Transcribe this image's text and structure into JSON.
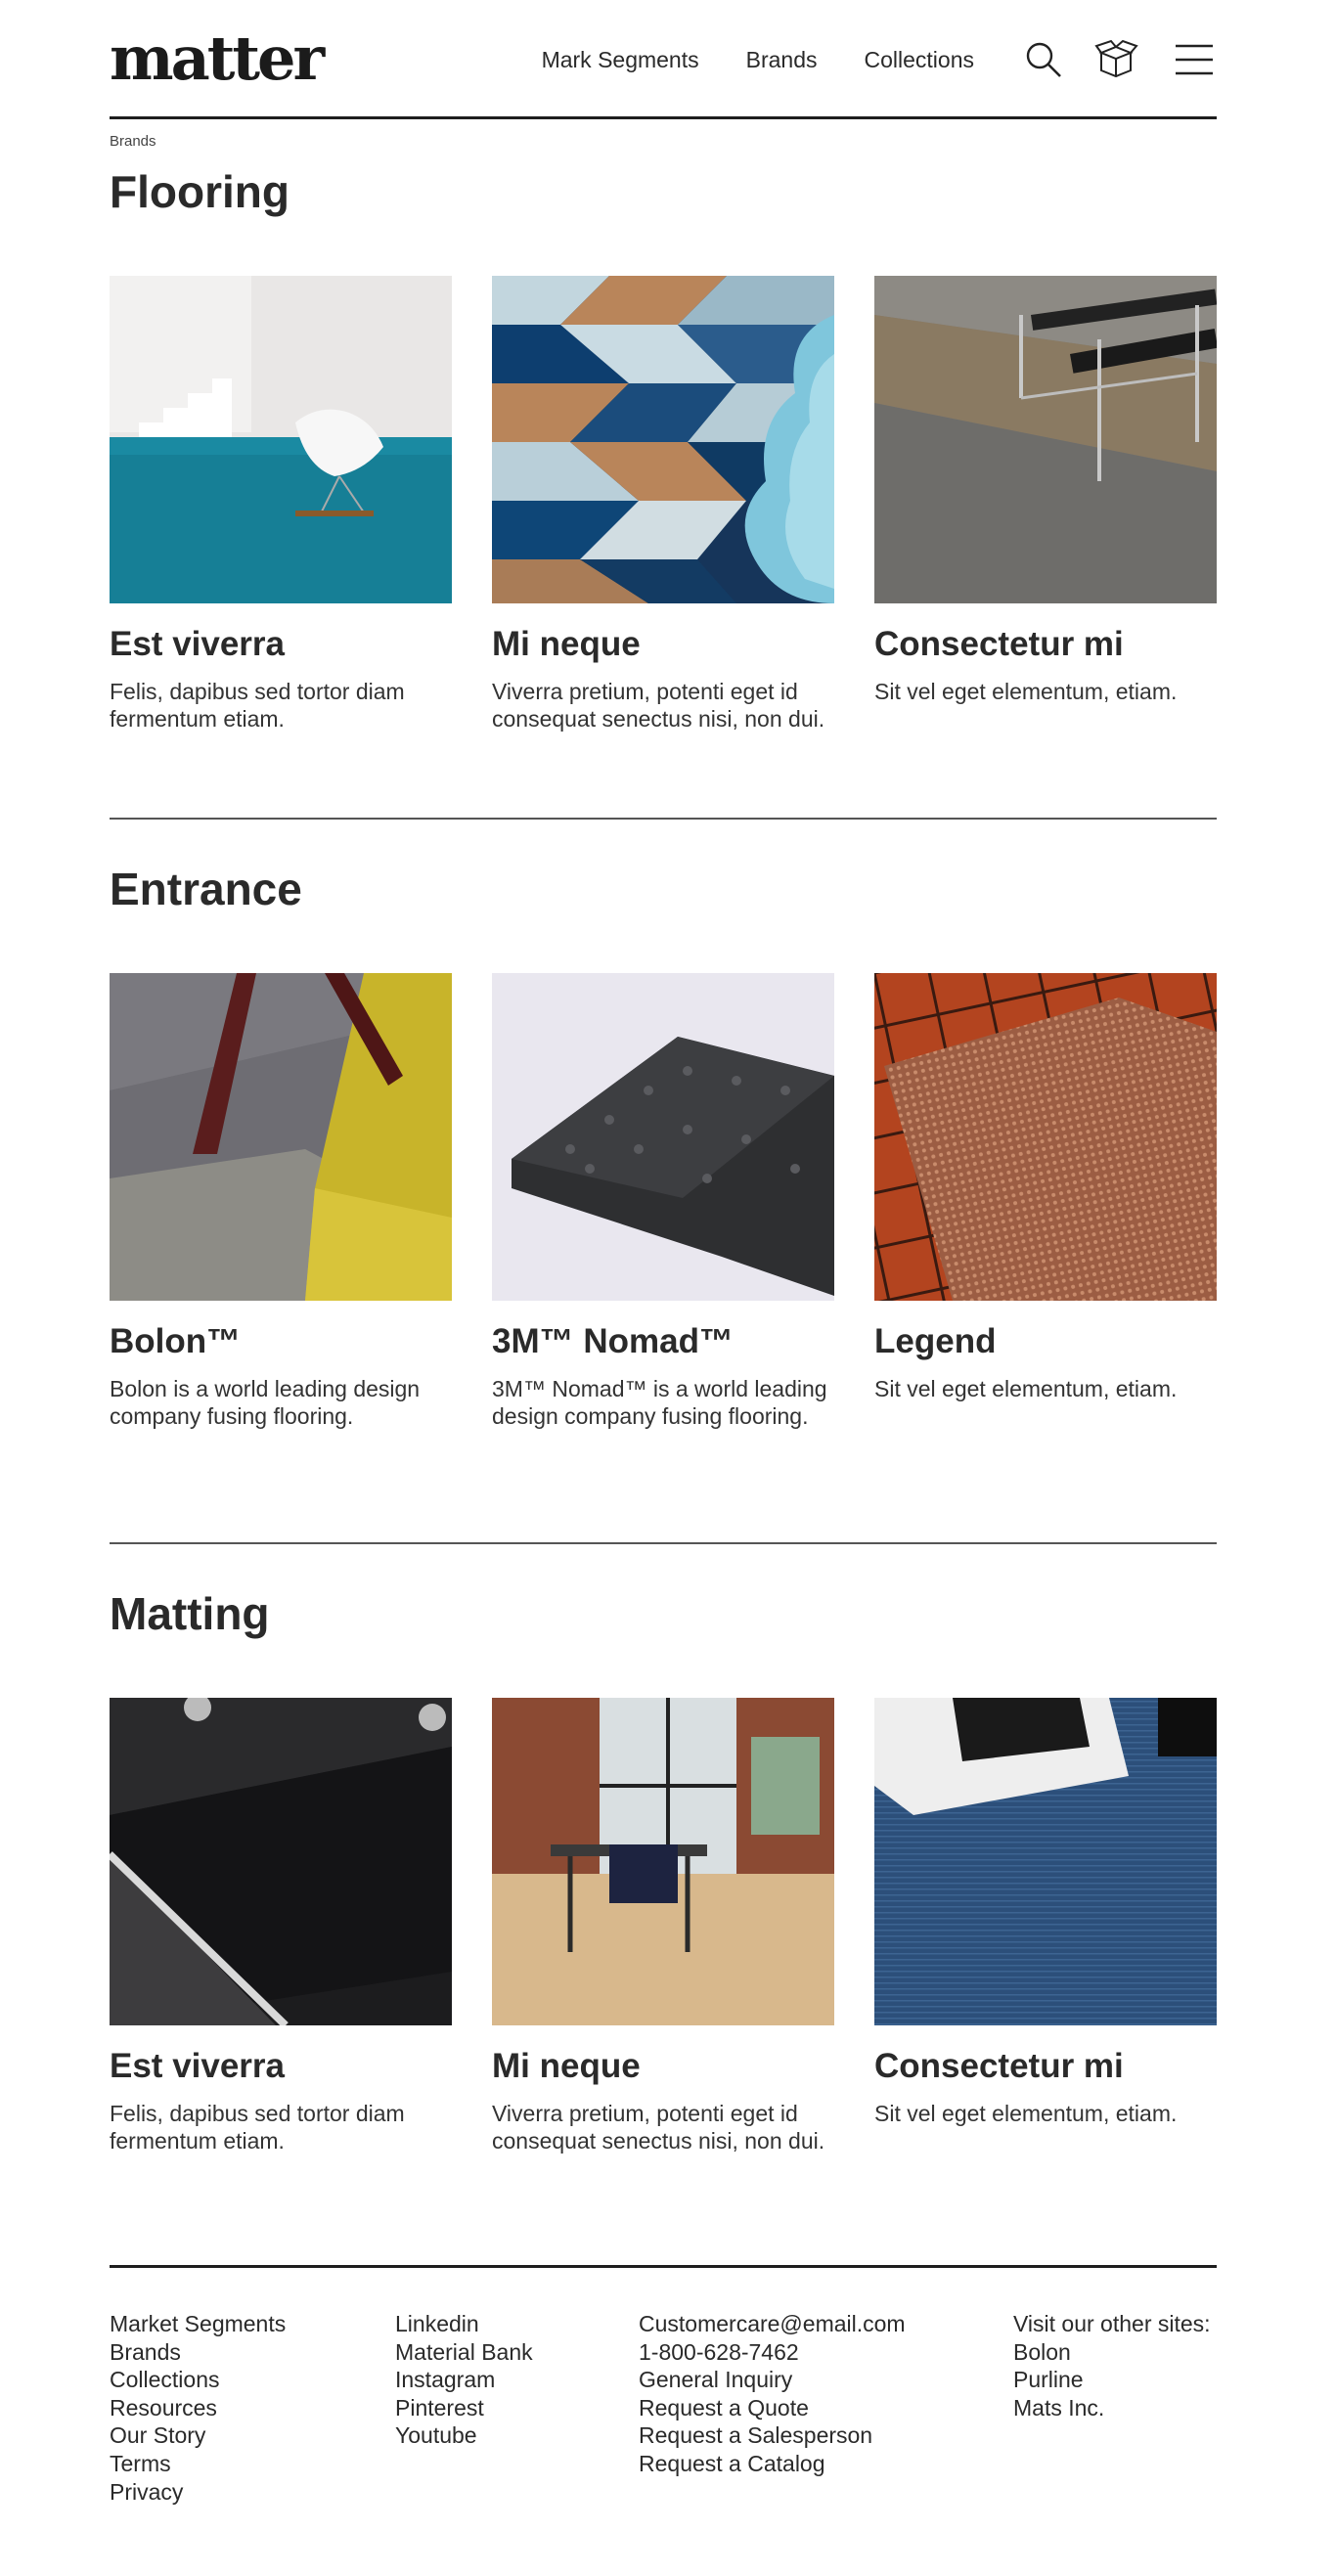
{
  "header": {
    "logo": "matter",
    "nav": [
      "Mark Segments",
      "Brands",
      "Collections"
    ],
    "icons": [
      "search-icon",
      "box-icon",
      "menu-icon"
    ]
  },
  "breadcrumb": "Brands",
  "sections": [
    {
      "title": "Flooring",
      "cards": [
        {
          "title": "Est viverra",
          "desc": "Felis, dapibus sed tortor diam fermentum etiam."
        },
        {
          "title": "Mi neque",
          "desc": "Viverra pretium, potenti eget id consequat senectus nisi, non dui."
        },
        {
          "title": "Consectetur mi",
          "desc": "Sit vel eget elementum, etiam."
        }
      ]
    },
    {
      "title": "Entrance",
      "cards": [
        {
          "title": "Bolon™",
          "desc": "Bolon is a world leading design company fusing flooring."
        },
        {
          "title": "3M™ Nomad™",
          "desc": "3M™ Nomad™ is a world leading design company fusing flooring."
        },
        {
          "title": "Legend",
          "desc": "Sit vel eget elementum, etiam."
        }
      ]
    },
    {
      "title": "Matting",
      "cards": [
        {
          "title": "Est viverra",
          "desc": "Felis, dapibus sed tortor diam fermentum etiam."
        },
        {
          "title": "Mi neque",
          "desc": "Viverra pretium, potenti eget id consequat senectus nisi, non dui."
        },
        {
          "title": "Consectetur mi",
          "desc": "Sit vel eget elementum, etiam."
        }
      ]
    }
  ],
  "footer": {
    "col1": [
      "Market Segments",
      "Brands",
      "Collections",
      "Resources",
      "Our Story",
      "Terms",
      "Privacy"
    ],
    "col2": [
      "Linkedin",
      "Material Bank",
      "Instagram",
      "Pinterest",
      "Youtube"
    ],
    "col3": [
      "Customercare@email.com",
      "1-800-628-7462",
      "General Inquiry",
      "Request a Quote",
      "Request a Salesperson",
      "Request a Catalog"
    ],
    "col4_heading": "Visit our other sites:",
    "col4": [
      "Bolon",
      "Purline",
      "Mats Inc."
    ]
  }
}
